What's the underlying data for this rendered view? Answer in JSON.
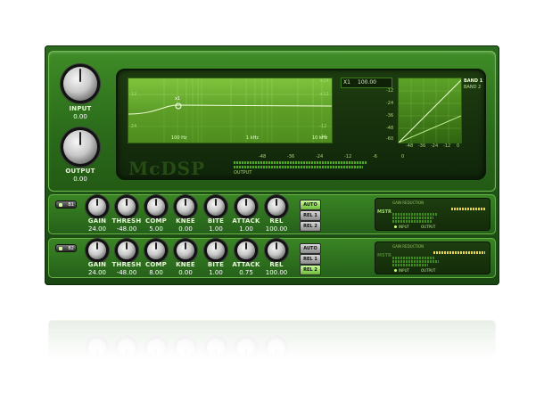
{
  "io": {
    "input_label": "INPUT",
    "input_value": "0.00",
    "output_label": "OUTPUT",
    "output_value": "0.00"
  },
  "eq": {
    "freq_labels": [
      "100 Hz",
      "1 kHz",
      "10 kHz"
    ],
    "left_ticks": [
      "-12",
      "-24"
    ],
    "right_ticks": [
      "+24",
      "+12",
      "-12",
      "-24"
    ],
    "point_label": "x1"
  },
  "readout": {
    "name": "X1",
    "value": "100.00"
  },
  "comp_graph": {
    "left_ticks": [
      "-12",
      "-24",
      "-36",
      "-48",
      "-60"
    ],
    "bottom_ticks": [
      "-48",
      "-36",
      "-24",
      "-12",
      "0"
    ],
    "band_labels": [
      "BAND 1",
      "BAND 2"
    ]
  },
  "logo": "McDSP",
  "meter": {
    "ticks": [
      "-48",
      "-36",
      "-24",
      "-12",
      "-6",
      "0"
    ],
    "label": "OUTPUT"
  },
  "param_labels": [
    "GAIN",
    "THRESH",
    "COMP",
    "KNEE",
    "BITE",
    "ATTACK",
    "REL"
  ],
  "mode_buttons": [
    "AUTO",
    "REL 1",
    "REL 2"
  ],
  "bands": [
    {
      "button": "B1",
      "values": [
        "24.00",
        "-48.00",
        "5.00",
        "0.00",
        "1.00",
        "1.00",
        "100.00"
      ],
      "active_mode": "AUTO",
      "mstr": "MSTR",
      "gr_title": "GAIN REDUCTION",
      "input_label": "INPUT",
      "output_label": "OUTPUT"
    },
    {
      "button": "B2",
      "values": [
        "24.00",
        "-48.00",
        "8.00",
        "0.00",
        "1.00",
        "0.75",
        "100.00"
      ],
      "active_mode": "REL 2",
      "mstr": "MSTR",
      "gr_title": "GAIN REDUCTION",
      "input_label": "INPUT",
      "output_label": "OUTPUT"
    }
  ]
}
